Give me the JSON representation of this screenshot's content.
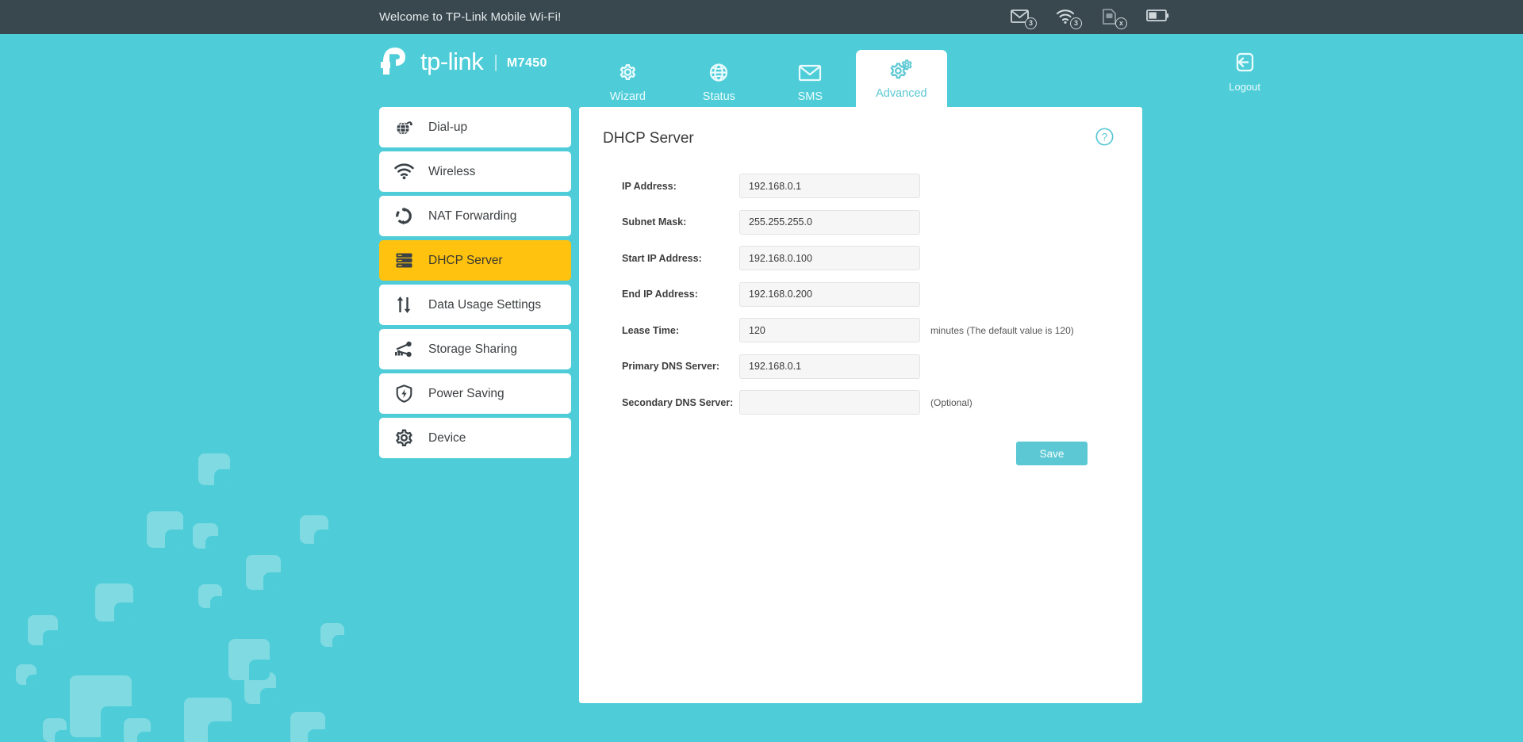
{
  "topbar": {
    "welcome": "Welcome to TP-Link Mobile Wi-Fi!",
    "icons": [
      {
        "name": "sms-icon",
        "badge": "3"
      },
      {
        "name": "wifi-icon",
        "badge": "3"
      },
      {
        "name": "sim-card-icon",
        "badge": "x"
      },
      {
        "name": "battery-icon",
        "badge": ""
      }
    ]
  },
  "header": {
    "brand": "tp-link",
    "separator": "|",
    "model": "M7450",
    "tabs": [
      {
        "label": "Wizard",
        "icon": "gear-icon",
        "active": false
      },
      {
        "label": "Status",
        "icon": "globe-icon",
        "active": false
      },
      {
        "label": "SMS",
        "icon": "envelope-icon",
        "active": false
      },
      {
        "label": "Advanced",
        "icon": "double-gear-icon",
        "active": true
      }
    ],
    "logout": {
      "label": "Logout",
      "icon": "logout-icon"
    }
  },
  "sidebar": {
    "items": [
      {
        "label": "Dial-up",
        "icon": "globe-arrow-icon",
        "active": false
      },
      {
        "label": "Wireless",
        "icon": "wifi-icon",
        "active": false
      },
      {
        "label": "NAT Forwarding",
        "icon": "refresh-icon",
        "active": false
      },
      {
        "label": "DHCP Server",
        "icon": "server-icon",
        "active": true
      },
      {
        "label": "Data Usage Settings",
        "icon": "up-down-arrows-icon",
        "active": false
      },
      {
        "label": "Storage Sharing",
        "icon": "share-icon",
        "active": false
      },
      {
        "label": "Power Saving",
        "icon": "shield-bolt-icon",
        "active": false
      },
      {
        "label": "Device",
        "icon": "gear-icon",
        "active": false
      }
    ]
  },
  "panel": {
    "title": "DHCP Server",
    "help_icon": "help-icon",
    "fields": [
      {
        "label": "IP Address:",
        "value": "192.168.0.1",
        "placeholder": "",
        "hint": ""
      },
      {
        "label": "Subnet Mask:",
        "value": "255.255.255.0",
        "placeholder": "",
        "hint": ""
      },
      {
        "label": "Start IP Address:",
        "value": "192.168.0.100",
        "placeholder": "",
        "hint": ""
      },
      {
        "label": "End IP Address:",
        "value": "192.168.0.200",
        "placeholder": "",
        "hint": ""
      },
      {
        "label": "Lease Time:",
        "value": "120",
        "placeholder": "",
        "hint": "minutes (The default value is 120)"
      },
      {
        "label": "Primary DNS Server:",
        "value": "192.168.0.1",
        "placeholder": "",
        "hint": ""
      },
      {
        "label": "Secondary DNS Server:",
        "value": "",
        "placeholder": "",
        "hint": "(Optional)"
      }
    ],
    "save_label": "Save"
  },
  "colors": {
    "accent_teal": "#4ECDD8",
    "deco_teal": "#80DAE2",
    "topbar_dark": "#39474F",
    "active_yellow": "#FFC20E",
    "save_button": "#5BC8D3"
  }
}
